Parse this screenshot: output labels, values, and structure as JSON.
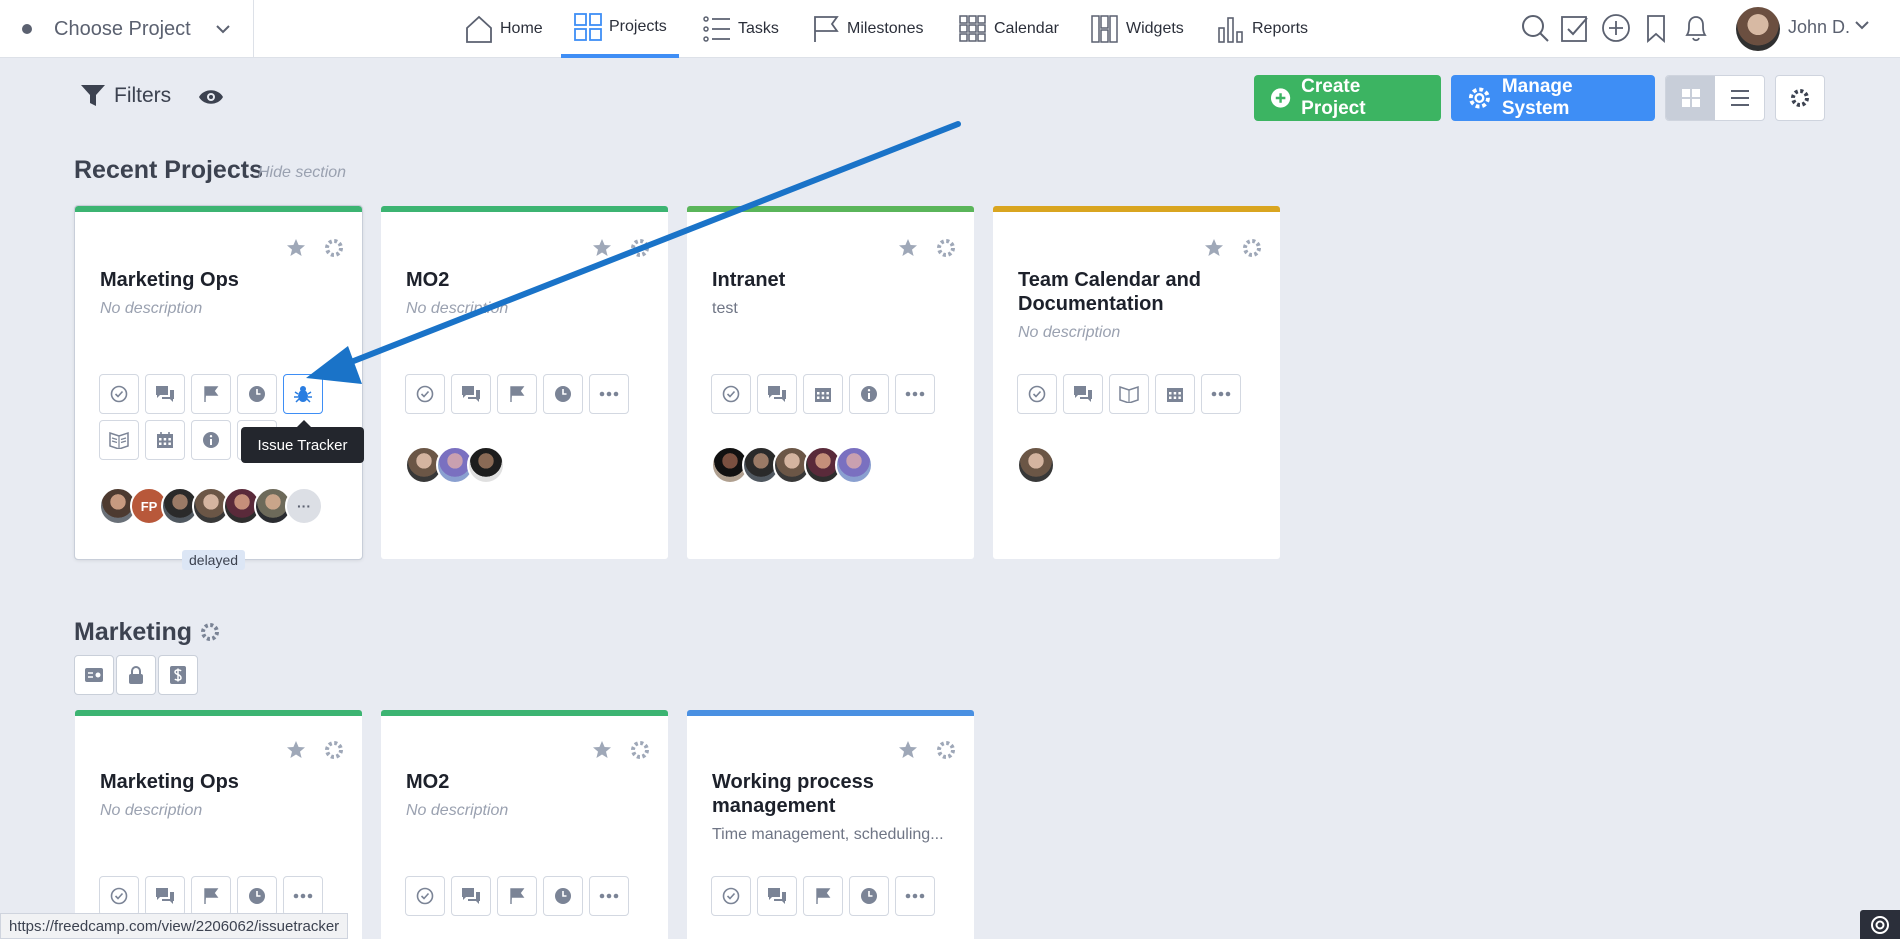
{
  "header": {
    "project_chooser": "Choose Project",
    "nav": [
      {
        "label": "Home",
        "icon": "home-icon"
      },
      {
        "label": "Projects",
        "icon": "projects-grid-icon",
        "active": true
      },
      {
        "label": "Tasks",
        "icon": "tasks-list-icon"
      },
      {
        "label": "Milestones",
        "icon": "milestone-flag-icon"
      },
      {
        "label": "Calendar",
        "icon": "calendar-grid-icon"
      },
      {
        "label": "Widgets",
        "icon": "widgets-icon"
      },
      {
        "label": "Reports",
        "icon": "reports-bar-icon"
      }
    ],
    "user_name": "John D."
  },
  "toolbar": {
    "filters_label": "Filters",
    "create_project": "Create Project",
    "manage_system": "Manage System"
  },
  "recent": {
    "title": "Recent Projects",
    "hide_link": "Hide section",
    "cards": [
      {
        "name": "Marketing Ops",
        "description": "No description",
        "color": "#3cb472"
      },
      {
        "name": "MO2",
        "description": "No description",
        "color": "#3cb472"
      },
      {
        "name": "Intranet",
        "description": "test",
        "color": "#5ab55a"
      },
      {
        "name": "Team Calendar and Documentation",
        "description": "No description",
        "color": "#d9a520"
      }
    ],
    "avatar_initials": "FP",
    "badge": "delayed",
    "tooltip": "Issue Tracker"
  },
  "marketing": {
    "title": "Marketing",
    "cards": [
      {
        "name": "Marketing Ops",
        "description": "No description",
        "color": "#3cb472"
      },
      {
        "name": "MO2",
        "description": "No description",
        "color": "#3cb472"
      },
      {
        "name": "Working process management",
        "description": "Time management, scheduling...",
        "color": "#4a90e2"
      }
    ]
  },
  "status_url": "https://freedcamp.com/view/2206062/issuetracker",
  "colors": {
    "accent": "#3e8ef5",
    "green": "#3cb462",
    "arrow": "#1a73c8"
  }
}
